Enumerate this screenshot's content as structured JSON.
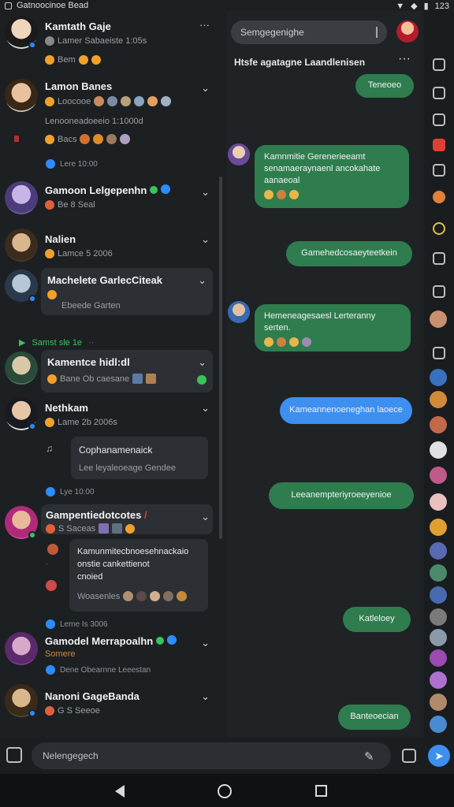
{
  "status_bar": {
    "app_label": "Gatnoocinoe Bead",
    "time": "123"
  },
  "chats": [
    {
      "name": "Kamtath Gaje",
      "sub": "Lamer Sabaeiste 1:05s",
      "meta": "Bem",
      "chevron": "···"
    },
    {
      "name": "Lamon Banes",
      "sub": "Loocooe",
      "line2": "Lenooneadoeeio 1:1000d",
      "line3": "Bacs",
      "time": "Lere 10:00",
      "chevron": "⌄"
    },
    {
      "name": "Gamoon Lelgepenhn",
      "sub": "Be 8 Seal",
      "chevron": "⌄"
    },
    {
      "name": "Nalien",
      "sub": "Lamce 5 2006",
      "chevron": "⌄"
    },
    {
      "name": "Machelete GarlecCiteak",
      "sub": "Ebeede Garten",
      "chevron": "⌄"
    },
    {
      "name": "Kamentce hidl:dl",
      "sub": "Bane Ob caesane",
      "chevron": "⌄"
    },
    {
      "name": "Nethkam",
      "sub": "Lame 2b 2006s",
      "quote_title": "Cophanamenaick",
      "quote_sub": "Lee leyaleoeage Gendee",
      "time": "Lye 10:00",
      "chevron": "⌄"
    },
    {
      "name": "Gampentiedotcotes",
      "sub": "S Saceas",
      "quote_title": "Kamunmitecbnoesehnackaio",
      "quote_line2": "onstie cankettienot",
      "quote_line3": "cnoied",
      "quote_meta": "Woasenles",
      "time": "Leme Is 3006",
      "chevron": "⌄"
    },
    {
      "name": "Gamodel Merrapoalhn",
      "sub": "Somere",
      "meta": "Dene Obearnne Leeestan",
      "chevron": "⌄"
    },
    {
      "name": "Nanoni GageBanda",
      "sub": "G S Seeoe",
      "chevron": "⌄"
    }
  ],
  "section_label": "Samst sle 1e",
  "search": {
    "placeholder": "Semgegenighe"
  },
  "conversation": {
    "title": "Htsfe agatagne Laandlenisen",
    "messages": [
      {
        "text": "Teneoeo",
        "side": "right",
        "color": "green"
      },
      {
        "text": "Kamnmitie Gerenerieeamt senamaeraynaenl ancokahate aanaeoal",
        "side": "left",
        "color": "green"
      },
      {
        "text": "Gamehedcosaeyteetkein",
        "side": "right",
        "color": "green"
      },
      {
        "text": "Hemeneagesaesl Lerteranny serten.",
        "side": "left",
        "color": "green"
      },
      {
        "text": "Kameannenoeneghan laoece",
        "side": "right",
        "color": "blue"
      },
      {
        "text": "Leeanempteriyroeeyenioe",
        "side": "right",
        "color": "green"
      },
      {
        "text": "Katleloey",
        "side": "right",
        "color": "green"
      },
      {
        "text": "Banteoecian",
        "side": "right",
        "color": "green"
      }
    ]
  },
  "input": {
    "placeholder": "Nelengegech"
  },
  "colors": {
    "green": "#2f7d4e",
    "blue": "#3d8ff0",
    "accent_green": "#39c35c"
  }
}
